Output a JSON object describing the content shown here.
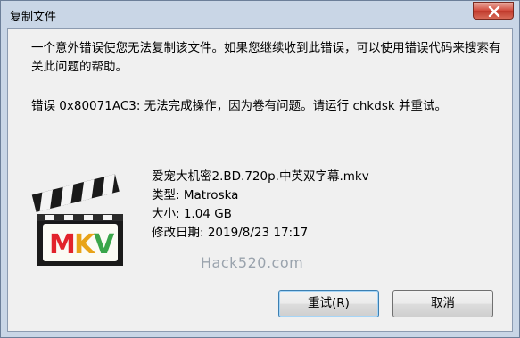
{
  "window": {
    "title": "复制文件"
  },
  "message": {
    "line1": "一个意外错误使您无法复制该文件。如果您继续收到此错误，可以使用错误代码来搜索有关此问题的帮助。",
    "line2": "错误 0x80071AC3: 无法完成操作，因为卷有问题。请运行 chkdsk 并重试。"
  },
  "file": {
    "icon": "mkv-clapperboard-icon",
    "icon_text": "MKV",
    "name": "爱宠大机密2.BD.720p.中英双字幕.mkv",
    "type": "类型: Matroska",
    "size": "大小: 1.04 GB",
    "modified": "修改日期: 2019/8/23 17:17"
  },
  "watermark": "Hack520.com",
  "buttons": {
    "retry": "重试(R)",
    "cancel": "取消"
  }
}
